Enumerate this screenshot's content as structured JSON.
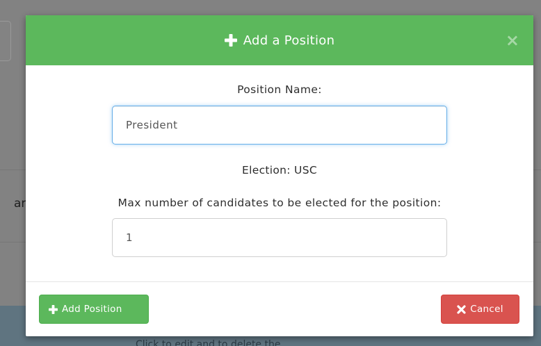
{
  "modal": {
    "title": "Add a Position",
    "close_symbol": "×",
    "position_name_label": "Position Name:",
    "position_name_value": "President",
    "election_text": "Election: USC",
    "max_candidates_label": "Max number of candidates to be elected for the position:",
    "max_candidates_value": "1",
    "add_button_label": "Add Position",
    "cancel_button_label": "Cancel"
  },
  "background": {
    "partial_text": "ar",
    "bottom_hint": "Click  to edit and  to delete the"
  },
  "icons": {
    "title": "plus-icon",
    "close": "close-icon",
    "add": "plus-icon",
    "cancel": "times-icon"
  },
  "colors": {
    "header_green": "#5cb85c",
    "add_button": "#5cb85c",
    "cancel_button": "#d9534f",
    "focus_border": "#66afe9"
  }
}
